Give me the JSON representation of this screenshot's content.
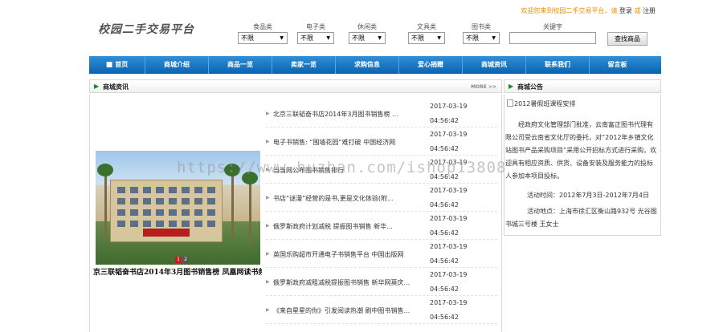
{
  "header": {
    "logo_text": "校园二手交易平台",
    "welcome": "欢迎您来到校园二手交易平台，请",
    "login": "登录",
    "or": "或",
    "register": "注册"
  },
  "filters": [
    {
      "label": "食品类",
      "value": "不限"
    },
    {
      "label": "电子类",
      "value": "不限"
    },
    {
      "label": "休闲类",
      "value": "不限"
    },
    {
      "label": "文具类",
      "value": "不限"
    },
    {
      "label": "图书类",
      "value": "不限"
    }
  ],
  "search": {
    "label": "关键字",
    "button": "查找商品"
  },
  "nav": [
    "首页",
    "商城介绍",
    "商品一览",
    "卖家一览",
    "求购信息",
    "爱心捐赠",
    "商城资讯",
    "联系我们",
    "留言板"
  ],
  "news_section": {
    "title": "商城资讯",
    "more": "MORE >>"
  },
  "notice_section": {
    "title": "商城公告"
  },
  "slider": {
    "caption": "京三联韬奋书店2014年3月图书销售榜 凤凰网读书频",
    "dots": [
      "1",
      "2"
    ]
  },
  "news": [
    {
      "title": "北京三联韬奋书店2014年3月图书销售榜 ...",
      "date": "2017-03-19",
      "time": "04:56:42"
    },
    {
      "title": "电子书销售: “围墙花园”难打破 中国经济网",
      "date": "2017-03-19",
      "time": "04:56:42"
    },
    {
      "title": "当当网公布图书销售排行",
      "date": "2017-03-19",
      "time": "04:56:42"
    },
    {
      "title": "书店“谜漫”经营的是书,更是文化体验(附...",
      "date": "2017-03-19",
      "time": "04:56:42"
    },
    {
      "title": "俄罗斯政府计划减税 提振图书销售 新华...",
      "date": "2017-03-19",
      "time": "04:56:42"
    },
    {
      "title": "英国乐购超市开通电子书销售平台 中国出版网",
      "date": "2017-03-19",
      "time": "04:56:42"
    },
    {
      "title": "俄罗斯政府减租减税提振图书销售 新华网莫庆...",
      "date": "2017-03-19",
      "time": "04:56:42"
    },
    {
      "title": "《来自星星的你》引发阅读热潮 刷中图书销售...",
      "date": "2017-03-19",
      "time": "04:56:42"
    }
  ],
  "notice": {
    "image_alt": "2012暑假班课程安排",
    "body": "经政府文化管理部门批准，云南富正图书代理有限公司受云南省文化厅的委托，对“2012年乡镇文化站图书产品采购项目”采用公开招标方式进行采购，欢迎具有相应资质、供货、设备安装及服务能力的投标人参加本项目投标。",
    "time_line": "活动时间：2012年7月3日-2012年7月4日",
    "place_line": "活动地点：上海市徐汇区衡山路932号 光谷图书城三号楼 王女士"
  },
  "watermark": "https://www.huzhan.com/ishop13808"
}
